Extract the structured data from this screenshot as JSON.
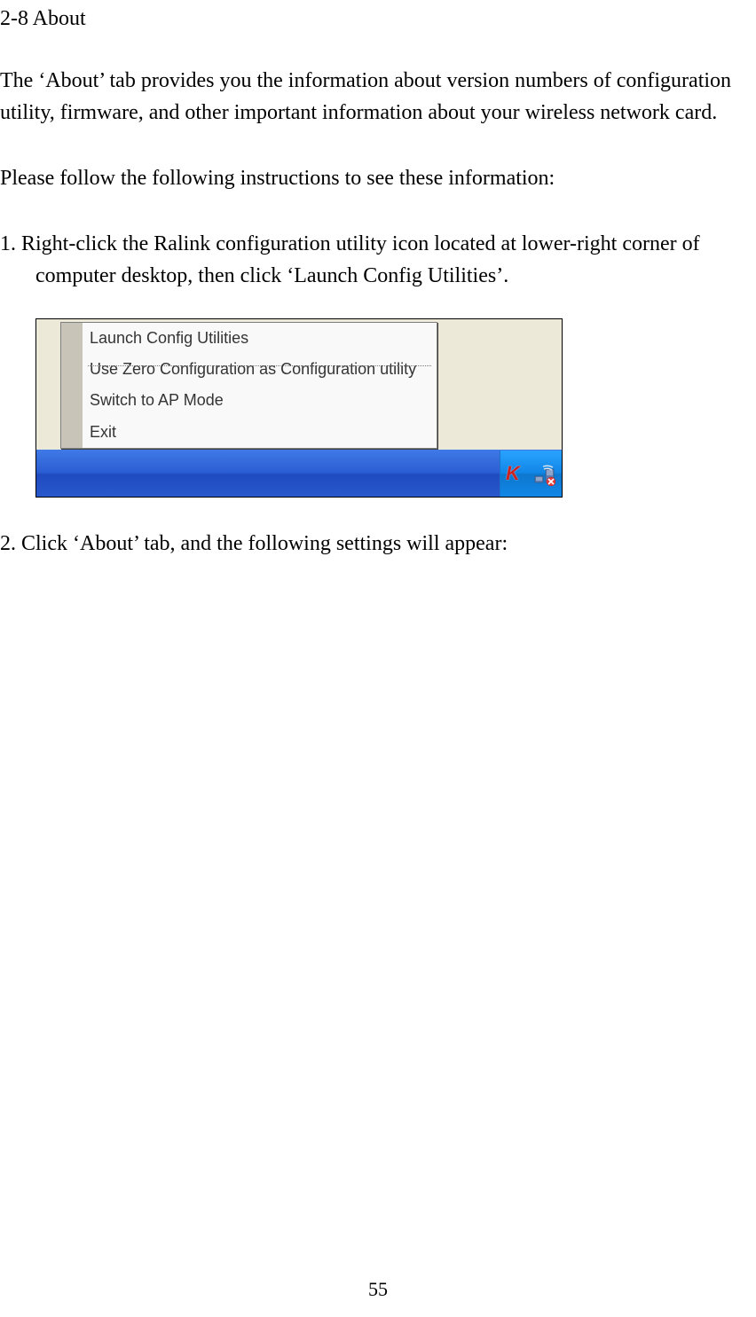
{
  "section_title": "2-8 About",
  "intro_paragraph": "The ‘About’ tab provides you the information about version numbers of configuration utility, firmware, and other important information about your wireless network card.",
  "instructions_paragraph": "Please follow the following instructions to see these information:",
  "step1": {
    "number": "1.",
    "text": "Right-click the Ralink configuration utility icon located at lower-right corner of computer desktop, then click ‘Launch Config Utilities’."
  },
  "context_menu": {
    "items": [
      "Launch Config Utilities",
      "Use Zero Configuration as Configuration utility",
      "Switch to AP Mode",
      "Exit"
    ]
  },
  "step2": "2. Click ‘About’ tab, and the following settings will appear:",
  "page_number": "55"
}
